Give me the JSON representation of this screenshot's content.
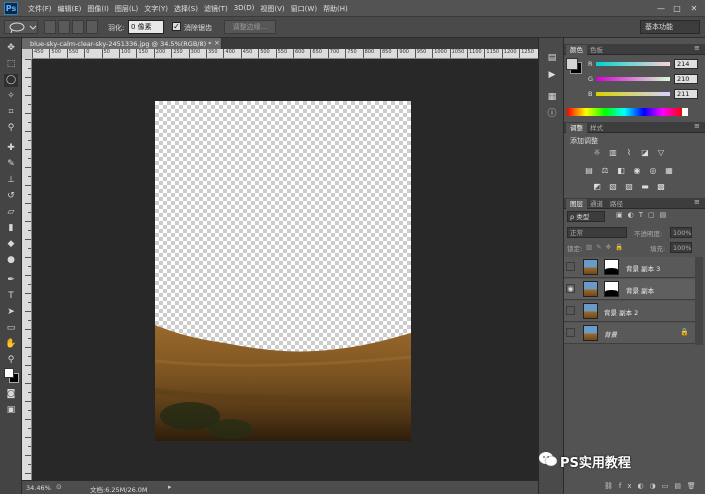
{
  "app": {
    "logo": "Ps"
  },
  "menu": [
    "文件(F)",
    "编辑(E)",
    "图像(I)",
    "图层(L)",
    "文字(Y)",
    "选择(S)",
    "滤镜(T)",
    "3D(D)",
    "视图(V)",
    "窗口(W)",
    "帮助(H)"
  ],
  "window_controls": [
    "—",
    "□",
    "✕"
  ],
  "options": {
    "feather_label": "羽化:",
    "feather_value": "0 像素",
    "antialias_label": "消除锯齿",
    "antialias_checked": "✓",
    "refine_edge": "调整边缘...",
    "workspace": "基本功能"
  },
  "document": {
    "tab_title": "blue-sky-calm-clear-sky-2451336.jpg @ 34.5%(RGB/8) *",
    "close": "×"
  },
  "rulers": {
    "h_labels": [
      "450",
      "500",
      "550",
      "0",
      "50",
      "100",
      "150",
      "200",
      "250",
      "300",
      "350",
      "400",
      "450",
      "500",
      "550",
      "600",
      "650",
      "700",
      "750",
      "800",
      "850",
      "900",
      "950",
      "1000",
      "1050",
      "1100",
      "1150",
      "1200",
      "1250"
    ]
  },
  "status": {
    "zoom": "34.46%",
    "doc_size": "文档:6.25M/26.0M"
  },
  "color_panel": {
    "tabs": [
      "颜色",
      "色板"
    ],
    "r_label": "R",
    "g_label": "G",
    "b_label": "B",
    "r": "214",
    "g": "210",
    "b": "211",
    "fg_color": "#d6d2d3"
  },
  "adjustments_panel": {
    "tabs": [
      "调整",
      "样式"
    ],
    "title": "添加调整"
  },
  "layers_panel": {
    "tabs": [
      "图层",
      "通道",
      "路径"
    ],
    "filter": "ρ 类型",
    "blend_mode": "正常",
    "opacity_label": "不透明度:",
    "opacity_value": "100%",
    "lock_label": "锁定:",
    "fill_label": "填充:",
    "fill_value": "100%",
    "layers": [
      {
        "name": "背景 副本 3",
        "visible": false,
        "has_mask": true
      },
      {
        "name": "背景 副本",
        "visible": true,
        "has_mask": true
      },
      {
        "name": "背景 副本 2",
        "visible": false,
        "has_mask": false
      },
      {
        "name": "背景",
        "visible": false,
        "has_mask": false,
        "locked": true
      }
    ]
  },
  "watermark": {
    "text": "PS实用教程"
  }
}
